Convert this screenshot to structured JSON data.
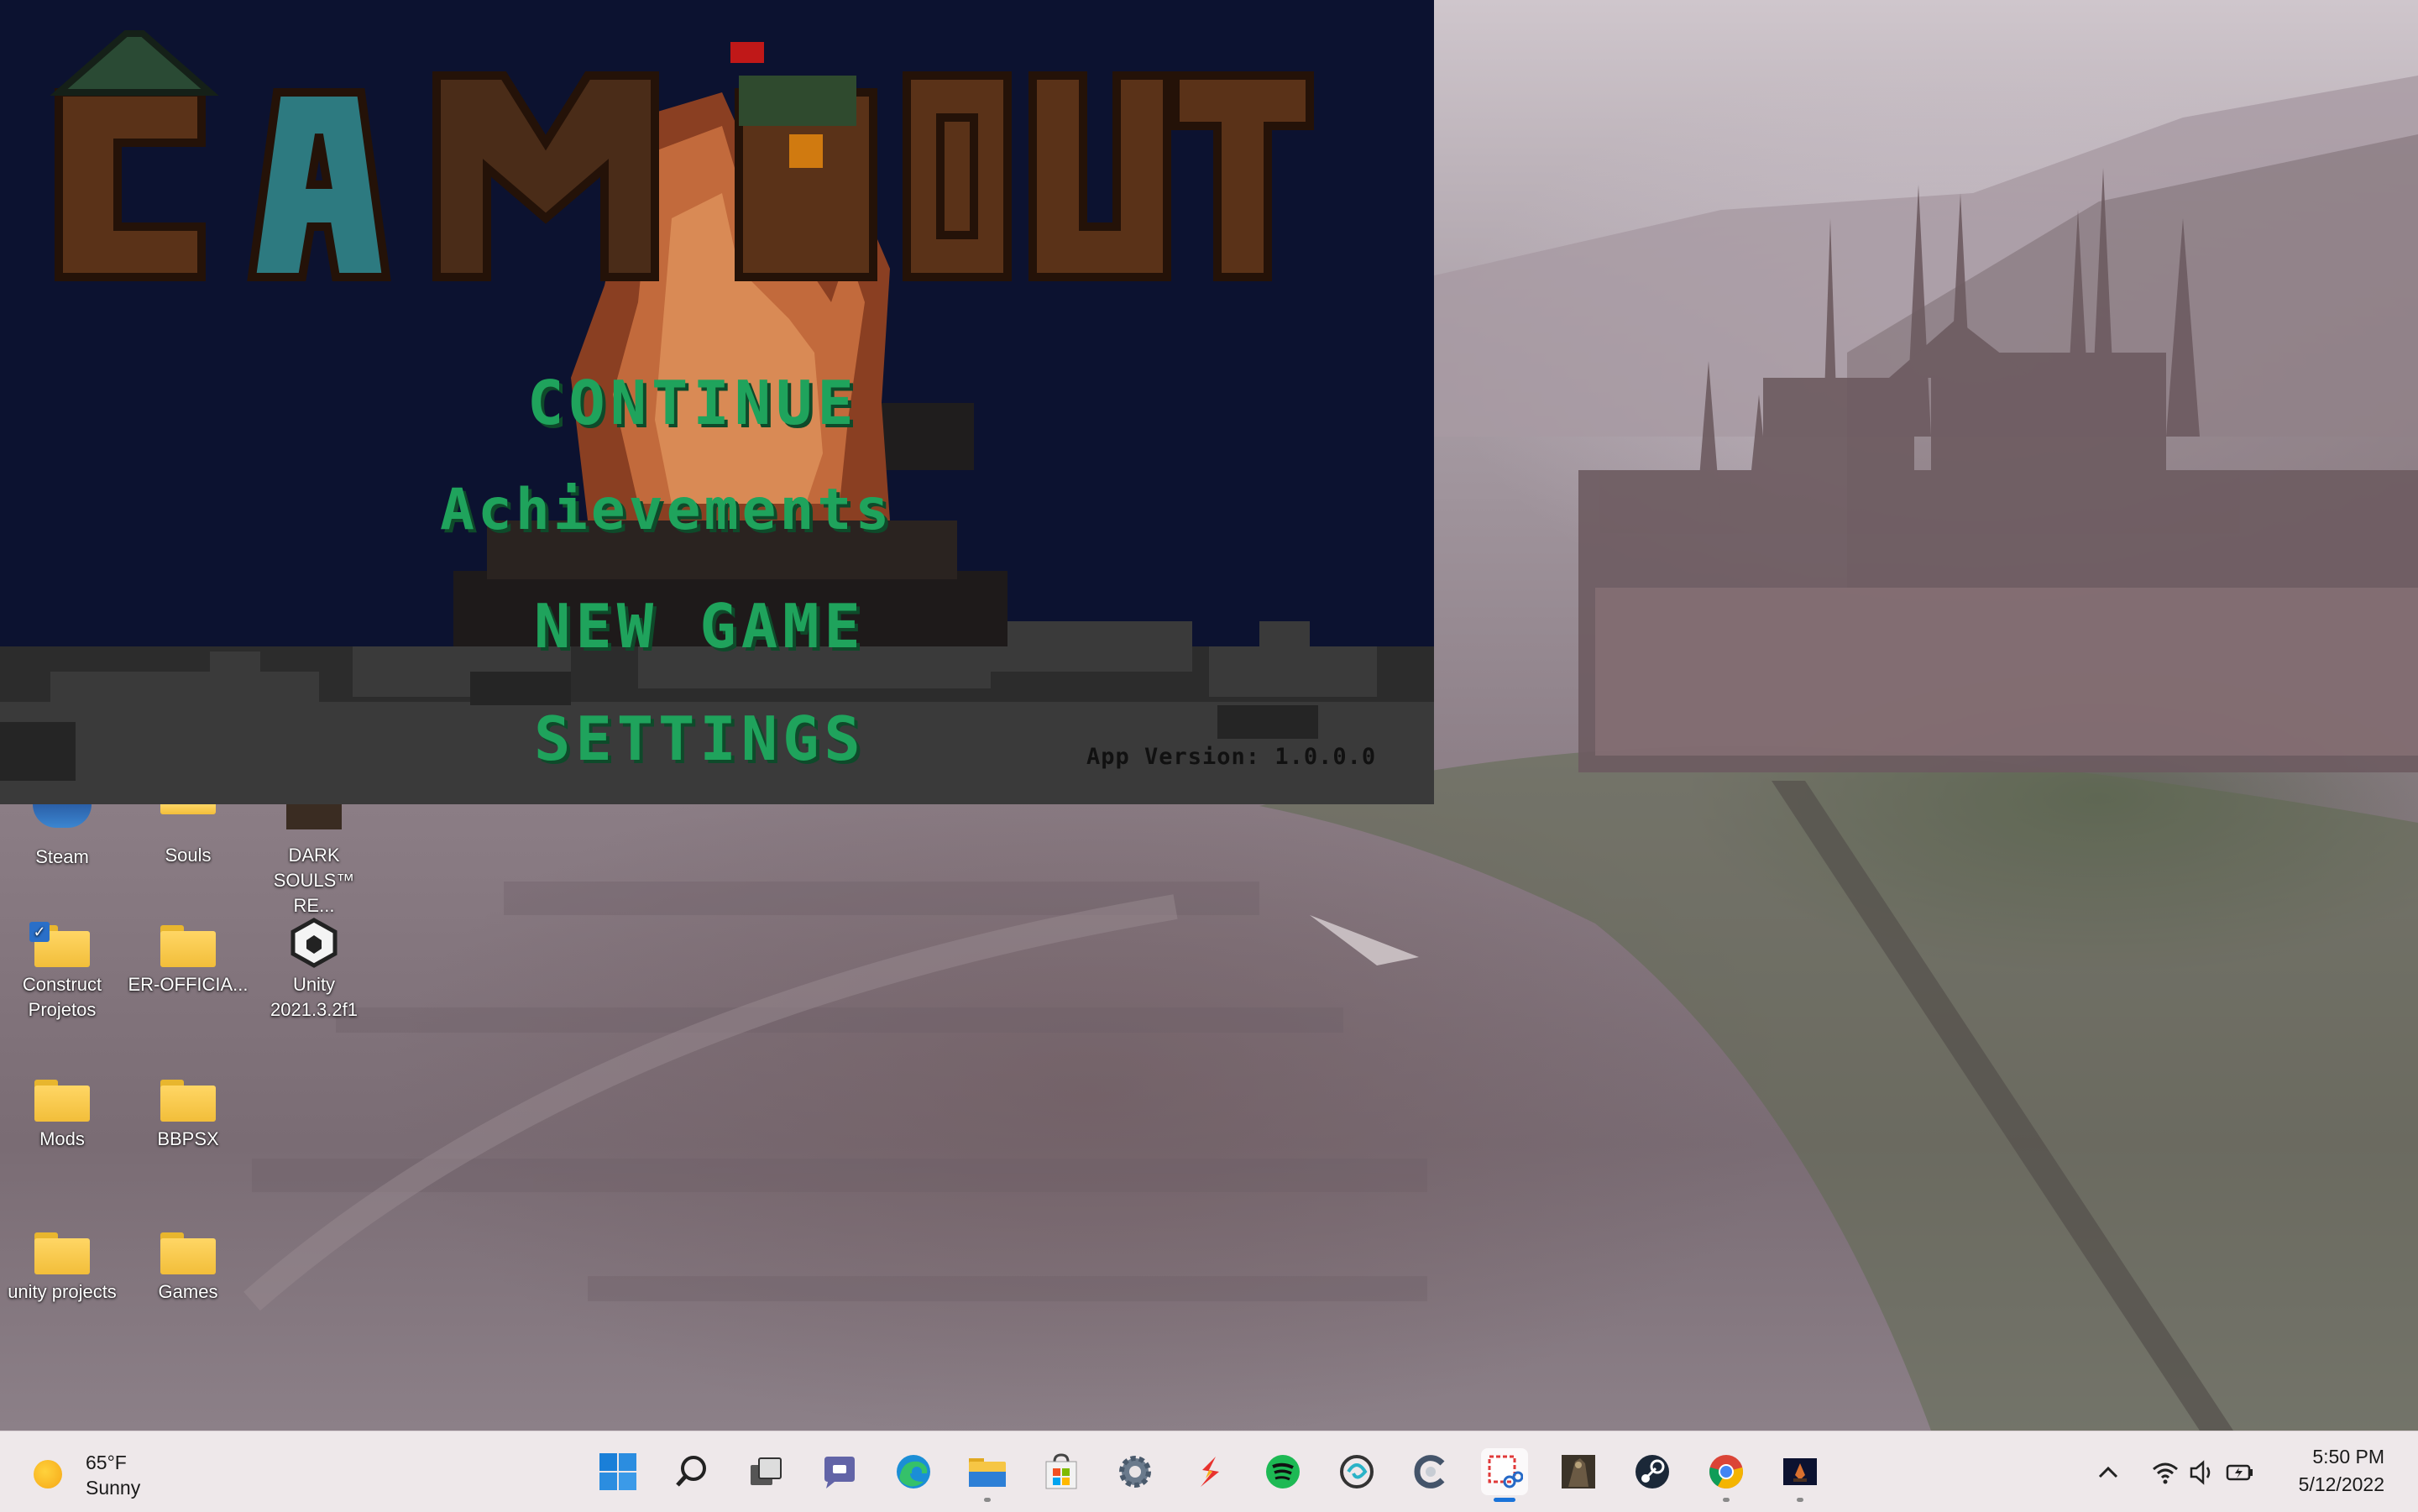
{
  "game": {
    "title_logo": "CAMPOUT",
    "menu": [
      {
        "label": "CONTINUE"
      },
      {
        "label": "Achievements"
      },
      {
        "label": "NEW GAME"
      },
      {
        "label": "SETTINGS"
      }
    ],
    "version": "App Version: 1.0.0.0",
    "colors": {
      "menu_text": "#1fa35c",
      "background": "#0c1230",
      "logo_brown": "#5a3218"
    }
  },
  "desktop": {
    "icons": [
      {
        "label": "Steam",
        "icon": "steam-icon"
      },
      {
        "label": "Souls",
        "icon": "folder-icon"
      },
      {
        "label": "DARK SOULS™ RE...",
        "icon": "dark-souls-icon"
      },
      {
        "label": "Construct Projetos",
        "icon": "folder-icon"
      },
      {
        "label": "ER-OFFICIA...",
        "icon": "folder-icon"
      },
      {
        "label": "Unity 2021.3.2f1",
        "icon": "unity-icon"
      },
      {
        "label": "Mods",
        "icon": "folder-icon"
      },
      {
        "label": "BBPSX",
        "icon": "folder-icon"
      },
      {
        "label": "unity projects",
        "icon": "folder-icon"
      },
      {
        "label": "Games",
        "icon": "folder-icon"
      }
    ]
  },
  "taskbar": {
    "weather": {
      "temp": "65°F",
      "condition": "Sunny",
      "icon": "sun-icon"
    },
    "apps": [
      {
        "name": "start",
        "icon": "windows-logo-icon"
      },
      {
        "name": "search",
        "icon": "search-icon"
      },
      {
        "name": "task-view",
        "icon": "task-view-icon"
      },
      {
        "name": "chat",
        "icon": "teams-chat-icon"
      },
      {
        "name": "edge",
        "icon": "edge-icon"
      },
      {
        "name": "file-explorer",
        "icon": "folder-icon"
      },
      {
        "name": "store",
        "icon": "microsoft-store-icon"
      },
      {
        "name": "settings",
        "icon": "gear-icon"
      },
      {
        "name": "app-red",
        "icon": "red-s-app-icon"
      },
      {
        "name": "spotify",
        "icon": "spotify-icon"
      },
      {
        "name": "app-swirl",
        "icon": "swirl-app-icon"
      },
      {
        "name": "ccleaner",
        "icon": "ccleaner-icon"
      },
      {
        "name": "snipping-tool",
        "icon": "snipping-tool-icon"
      },
      {
        "name": "game-dark",
        "icon": "dark-game-icon"
      },
      {
        "name": "steam",
        "icon": "steam-icon"
      },
      {
        "name": "chrome",
        "icon": "chrome-icon"
      },
      {
        "name": "campout",
        "icon": "campfire-icon"
      }
    ],
    "tray": {
      "icons": [
        "chevron-up-icon",
        "wifi-icon",
        "volume-icon",
        "battery-icon"
      ]
    },
    "clock": {
      "time": "5:50 PM",
      "date": "5/12/2022"
    }
  }
}
